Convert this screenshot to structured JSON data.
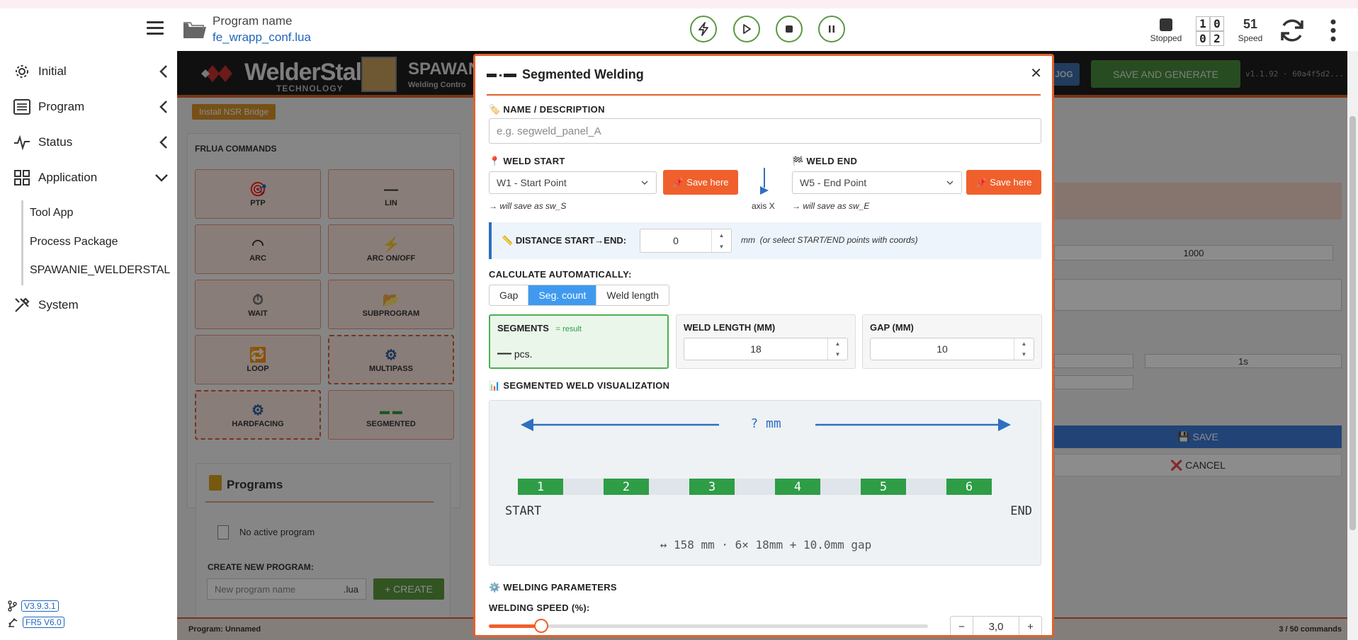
{
  "topbar": {
    "program_label": "Program name",
    "program_file": "fe_wrapp_conf.lua",
    "status_label": "Stopped",
    "counter": [
      "1",
      "0",
      "0",
      "2"
    ],
    "speed_value": "51",
    "speed_label": "Speed"
  },
  "sidebar": {
    "items": [
      {
        "label": "Initial",
        "icon": "gear-icon"
      },
      {
        "label": "Program",
        "icon": "list-icon"
      },
      {
        "label": "Status",
        "icon": "pulse-icon"
      },
      {
        "label": "Application",
        "icon": "grid-icon"
      },
      {
        "label": "System",
        "icon": "tools-icon"
      }
    ],
    "sub_items": [
      "Tool App",
      "Process Package",
      "SPAWANIE_WELDERSTAL"
    ],
    "version_app": "V3.9.3.1",
    "version_fr": "FR5 V6.0"
  },
  "app": {
    "logo_text": "WelderStal",
    "logo_sub": "TECHNOLOGY",
    "title": "SPAWAN",
    "subtitle": "Welding Contro",
    "jog_label": "JOG",
    "save_generate_label": "SAVE AND GENERATE",
    "version": "v1.1.92 · 60a4f5d2...",
    "nsr_label": "Install NSR Bridge",
    "commands_title": "FRLUA COMMANDS",
    "commands": [
      {
        "label": "PTP",
        "icon": "🎯"
      },
      {
        "label": "LIN",
        "icon": "—"
      },
      {
        "label": "ARC",
        "icon": "◠"
      },
      {
        "label": "ARC ON/OFF",
        "icon": "⚡"
      },
      {
        "label": "WAIT",
        "icon": "⏱"
      },
      {
        "label": "SUBPROGRAM",
        "icon": "📂"
      },
      {
        "label": "LOOP",
        "icon": "🔁"
      },
      {
        "label": "MULTIPASS",
        "icon": "⚙"
      },
      {
        "label": "HARDFACING",
        "icon": "⚙"
      },
      {
        "label": "SEGMENTED",
        "icon": "▬ ▬"
      }
    ],
    "programs_title": "Programs",
    "no_active": "No active program",
    "create_title": "CREATE NEW PROGRAM:",
    "create_placeholder": "New program name",
    "create_ext": ".lua",
    "create_button": "+ CREATE",
    "field_1000": "1000",
    "field_1s": "1s",
    "save_label": "💾 SAVE",
    "cancel_label": "❌ CANCEL",
    "footer_program": "Program: Unnamed",
    "footer_commands": "3 / 50 commands"
  },
  "modal": {
    "title": "Segmented Welding",
    "name_label": "NAME / DESCRIPTION",
    "name_placeholder": "e.g. segweld_panel_A",
    "weld_start_label": "WELD START",
    "weld_start_value": "W1 - Start Point",
    "save_here_label": "📌 Save here",
    "weld_start_hint": "→ will save as sw_S",
    "axis_label": "axis X",
    "weld_end_label": "WELD END",
    "weld_end_value": "W5 - End Point",
    "weld_end_hint": "→ will save as sw_E",
    "distance_label": "DISTANCE START→END:",
    "distance_value": "0",
    "distance_hint": "mm  (or select START/END points with coords)",
    "calc_label": "CALCULATE AUTOMATICALLY:",
    "calc_options": [
      "Gap",
      "Seg. count",
      "Weld length"
    ],
    "calc_active": 1,
    "segments_label": "SEGMENTS",
    "segments_result": "= result",
    "segments_value": "—",
    "segments_unit": "pcs.",
    "weld_length_label": "WELD LENGTH (MM)",
    "weld_length_value": "18",
    "gap_label": "GAP (MM)",
    "gap_value": "10",
    "viz_label": "SEGMENTED WELD VISUALIZATION",
    "viz_dimension": "? mm",
    "viz_segments": [
      "1",
      "2",
      "3",
      "4",
      "5",
      "6"
    ],
    "viz_start": "START",
    "viz_end": "END",
    "viz_summary": "↔ 158 mm · 6× 18mm + 10.0mm gap",
    "params_label": "WELDING PARAMETERS",
    "speed_label": "WELDING SPEED (%):",
    "speed_value": "3,0",
    "speed_fraction": 0.12,
    "minus": "−",
    "plus": "+"
  }
}
